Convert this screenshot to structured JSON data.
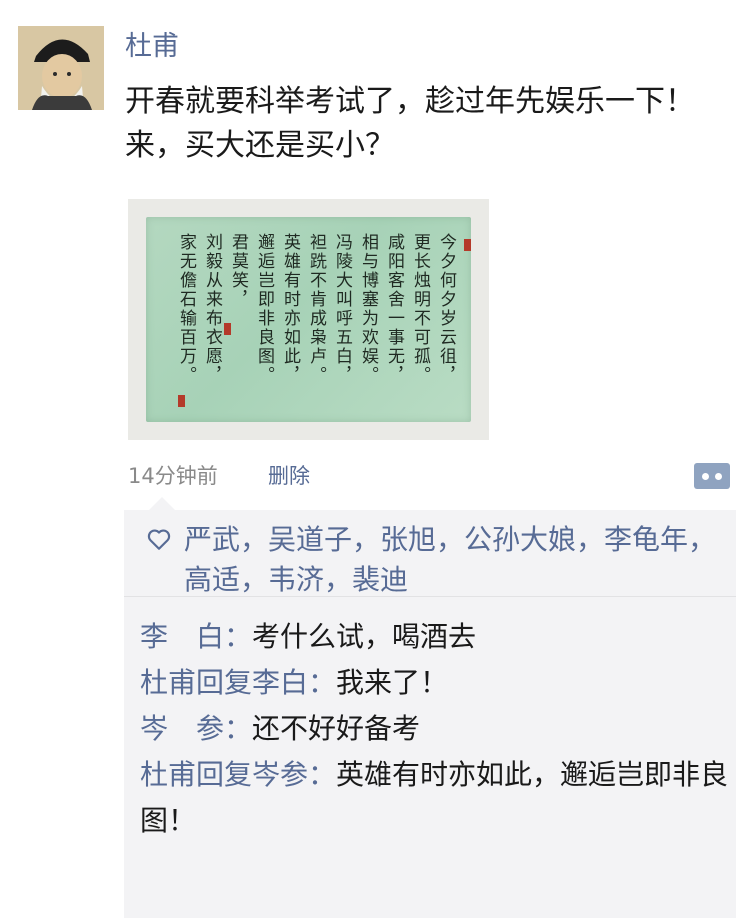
{
  "post": {
    "author": "杜甫",
    "text": "开春就要科举考试了，趁过年先娱乐一下！来，买大还是买小？",
    "image_text_columns": [
      "今夕何夕岁云徂，",
      "更长烛明不可孤。",
      "咸阳客舍一事无，",
      "相与博塞为欢娱。",
      "冯陵大叫呼五白，",
      "袒跣不肯成枭卢。",
      "英雄有时亦如此，",
      "邂逅岂即非良图。",
      "君莫笑，",
      "刘毅从来布衣愿，",
      "家无儋石输百万。"
    ],
    "time": "14分钟前",
    "delete_label": "删除"
  },
  "likes": {
    "names": "严武，吴道子，张旭，公孙大娘，李龟年，高适，韦济，裴迪"
  },
  "comments": [
    {
      "name": "李　白",
      "sep": "：",
      "text": "考什么试，喝酒去"
    },
    {
      "name": "杜甫回复李白",
      "sep": "：",
      "text": "我来了！"
    },
    {
      "name": "岑　参",
      "sep": "：",
      "text": "还不好好备考"
    },
    {
      "name": "杜甫回复岑参",
      "sep": "：",
      "text": "英雄有时亦如此，邂逅岂即非良图！"
    }
  ],
  "colors": {
    "link": "#576b95",
    "panel_bg": "#f3f3f5"
  }
}
